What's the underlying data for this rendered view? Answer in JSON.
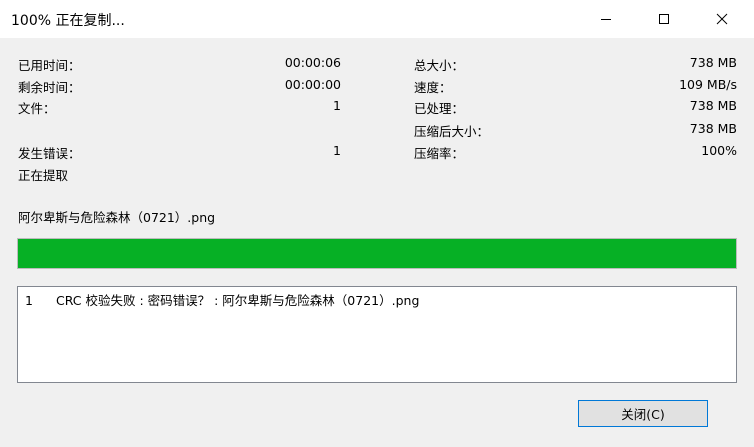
{
  "window": {
    "title": "100% 正在复制..."
  },
  "stats_left": [
    {
      "label": "已用时间：",
      "value": "00:00:06"
    },
    {
      "label": "剩余时间：",
      "value": "00:00:00"
    },
    {
      "label": "文件：",
      "value": "1"
    },
    {
      "label": "发生错误：",
      "value": "1"
    }
  ],
  "stats_right": [
    {
      "label": "总大小：",
      "value": "738 MB"
    },
    {
      "label": "速度：",
      "value": "109 MB/s"
    },
    {
      "label": "已处理：",
      "value": "738 MB"
    },
    {
      "label": "压缩后大小：",
      "value": "738 MB"
    },
    {
      "label": "压缩率：",
      "value": "100%"
    }
  ],
  "status_text": "正在提取",
  "current_file": "阿尔卑斯与危险森林（0721）.png",
  "progress": {
    "percent": 100,
    "color": "#06b025"
  },
  "log": [
    {
      "num": "1",
      "message": "CRC 校验失败 : 密码错误？ : 阿尔卑斯与危险森林（0721）.png"
    }
  ],
  "buttons": {
    "close_label": "关闭(C)"
  },
  "icons": [
    "minimize-icon",
    "maximize-icon",
    "close-icon"
  ]
}
